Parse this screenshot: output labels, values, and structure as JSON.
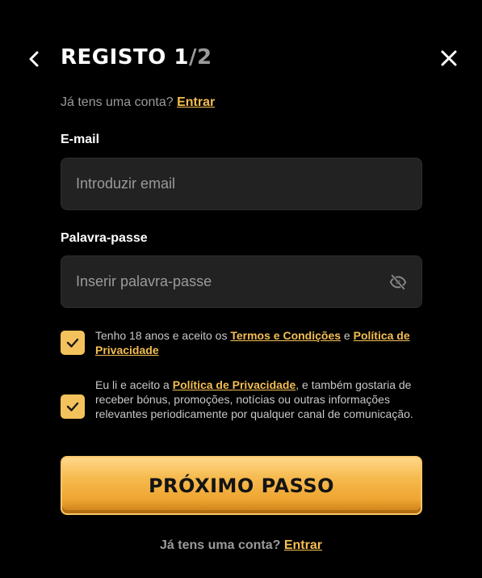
{
  "header": {
    "title_main": "REGISTO 1",
    "title_sep": "/",
    "title_total": "2"
  },
  "login_prompt": {
    "text": "Já tens uma conta?",
    "link": "Entrar"
  },
  "email": {
    "label": "E-mail",
    "placeholder": "Introduzir email",
    "value": ""
  },
  "password": {
    "label": "Palavra-passe",
    "placeholder": "Inserir palavra-passe",
    "value": ""
  },
  "consent_age": {
    "checked": true,
    "text_before": "Tenho 18 anos e aceito os",
    "terms_link": "Termos e Condições",
    "text_and": "e",
    "privacy_link": "Política de Privacidade"
  },
  "consent_marketing": {
    "checked": true,
    "text_before": "Eu li e aceito a",
    "privacy_link": "Política de Privacidade",
    "text_after": ", e também gostaria de receber bónus, promoções, notícias ou outras informações relevantes periodicamente por qualquer canal de comunicação."
  },
  "next_button": {
    "label": "PRÓXIMO PASSO"
  },
  "bottom_login": {
    "text": "Já tens uma conta?",
    "link": "Entrar"
  },
  "colors": {
    "accent": "#f4be52",
    "background": "#000000",
    "input_bg": "#222222",
    "muted_text": "#9a9a9a"
  },
  "icons": {
    "back": "chevron-left-icon",
    "close": "close-icon",
    "password_toggle": "eye-off-icon",
    "checkbox_mark": "checkmark-icon"
  }
}
